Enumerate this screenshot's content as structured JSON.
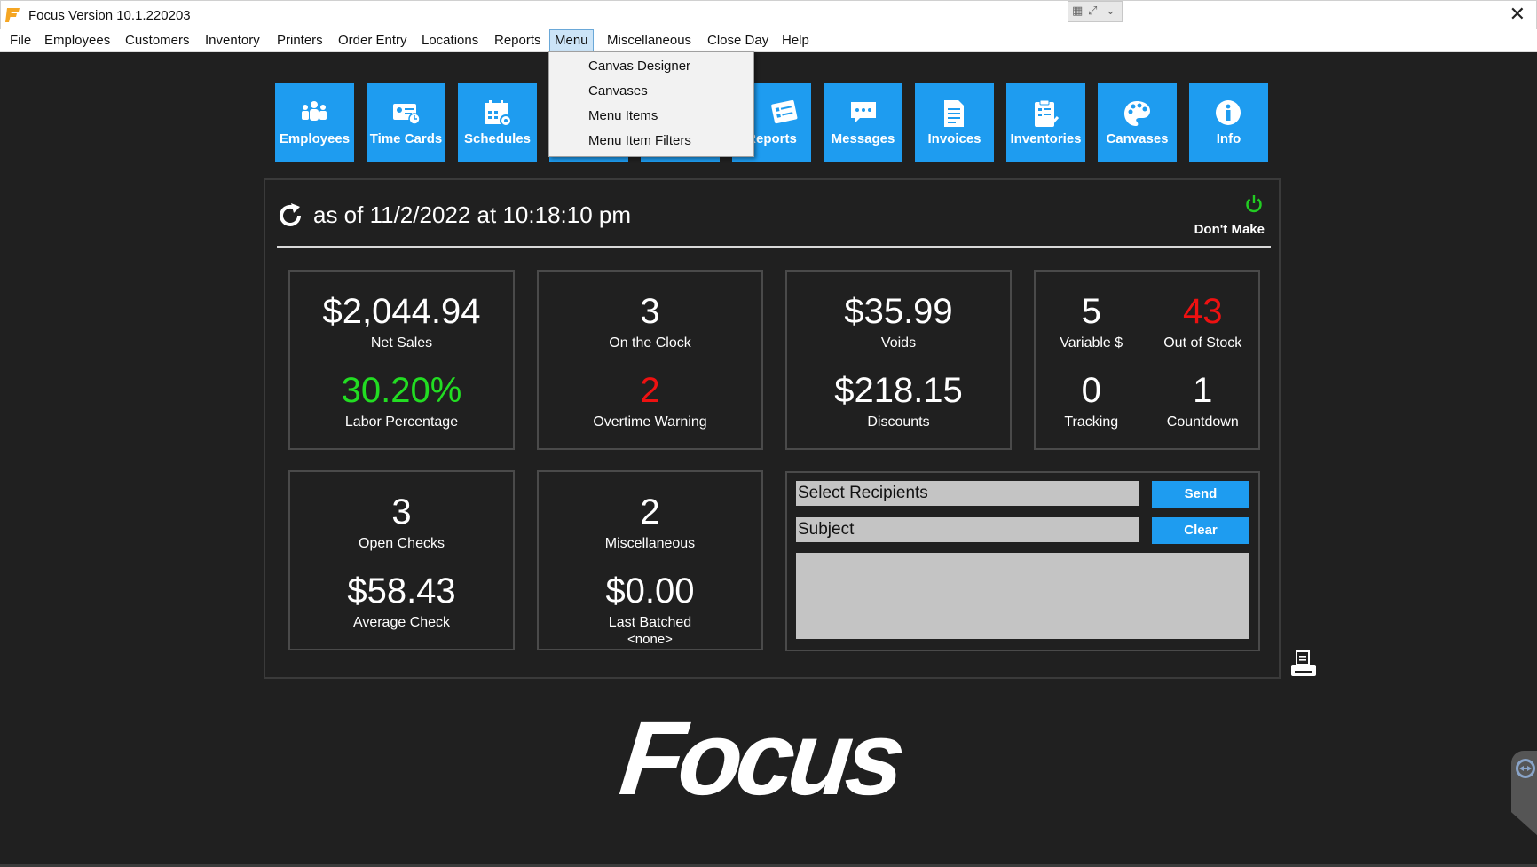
{
  "window": {
    "title": "Focus  Version 10.1.220203"
  },
  "menubar": {
    "items": [
      {
        "label": "File"
      },
      {
        "label": "Employees"
      },
      {
        "label": "Customers"
      },
      {
        "label": "Inventory"
      },
      {
        "label": "Printers"
      },
      {
        "label": "Order Entry"
      },
      {
        "label": "Locations"
      },
      {
        "label": "Reports"
      },
      {
        "label": "Menu",
        "open": true
      },
      {
        "label": "Miscellaneous"
      },
      {
        "label": "Close Day"
      },
      {
        "label": "Help"
      }
    ],
    "dropdown": {
      "items": [
        {
          "label": "Canvas Designer"
        },
        {
          "label": "Canvases"
        },
        {
          "label": "Menu Items"
        },
        {
          "label": "Menu Item Filters"
        }
      ]
    }
  },
  "toolbar": {
    "buttons": [
      {
        "label": "Employees",
        "icon": "employees-icon"
      },
      {
        "label": "Time Cards",
        "icon": "time-cards-icon"
      },
      {
        "label": "Schedules",
        "icon": "schedules-icon"
      },
      {
        "label": "",
        "icon": "hidden-button"
      },
      {
        "label": "",
        "icon": "hidden-button"
      },
      {
        "label": "Reports",
        "icon": "reports-icon"
      },
      {
        "label": "Messages",
        "icon": "messages-icon"
      },
      {
        "label": "Invoices",
        "icon": "invoices-icon"
      },
      {
        "label": "Inventories",
        "icon": "inventories-icon"
      },
      {
        "label": "Canvases",
        "icon": "canvases-icon"
      },
      {
        "label": "Info",
        "icon": "info-icon"
      }
    ]
  },
  "dashboard": {
    "as_of": "as of 11/2/2022 at 10:18:10 pm",
    "dont_make": "Don't Make",
    "sales": {
      "value": "$2,044.94",
      "label": "Net Sales",
      "value2": "30.20%",
      "label2": "Labor Percentage"
    },
    "clock": {
      "value": "3",
      "label": "On the Clock",
      "value2": "2",
      "label2": "Overtime Warning"
    },
    "voids": {
      "value": "$35.99",
      "label": "Voids",
      "value2": "$218.15",
      "label2": "Discounts"
    },
    "stock": {
      "variable_value": "5",
      "variable_label": "Variable $",
      "out_value": "43",
      "out_label": "Out of Stock",
      "tracking_value": "0",
      "tracking_label": "Tracking",
      "countdown_value": "1",
      "countdown_label": "Countdown"
    },
    "checks": {
      "value": "3",
      "label": "Open Checks",
      "value2": "$58.43",
      "label2": "Average Check"
    },
    "misc": {
      "value": "2",
      "label": "Miscellaneous",
      "value2": "$0.00",
      "label2": "Last Batched",
      "sub2": "<none>"
    },
    "message": {
      "recipients_placeholder": "Select Recipients",
      "subject_placeholder": "Subject",
      "send_label": "Send",
      "clear_label": "Clear",
      "body": ""
    }
  },
  "brand": {
    "logo_text": "Focus"
  },
  "colors": {
    "accent": "#1e9cf0",
    "good": "#22dd22",
    "alert": "#ee1111",
    "background": "#202020"
  }
}
